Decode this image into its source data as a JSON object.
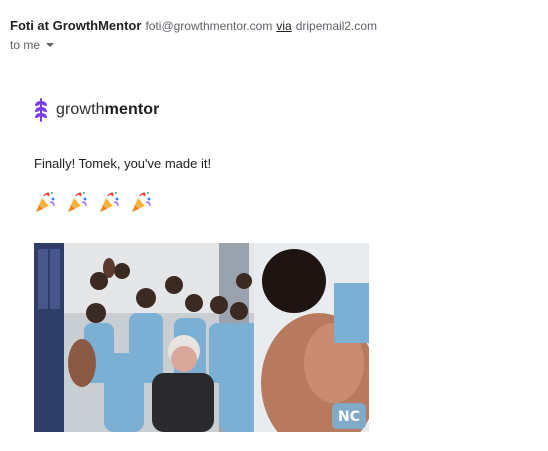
{
  "header": {
    "sender_name": "Foti at GrowthMentor",
    "sender_email": "foti@growthmentor.com",
    "via_label": "via",
    "relay_domain": "dripemail2.com",
    "to_label": "to me"
  },
  "body": {
    "logo": {
      "text_regular": "growth",
      "text_bold": "mentor",
      "color": "#7c3aed"
    },
    "greeting": "Finally! Tomek, you've made it!",
    "emojis": [
      "party-popper-icon",
      "party-popper-icon",
      "party-popper-icon",
      "party-popper-icon"
    ],
    "gif": {
      "description_icon": "celebration-gif",
      "badge": "nc-logo-icon",
      "accent": "#7bafd4"
    }
  }
}
